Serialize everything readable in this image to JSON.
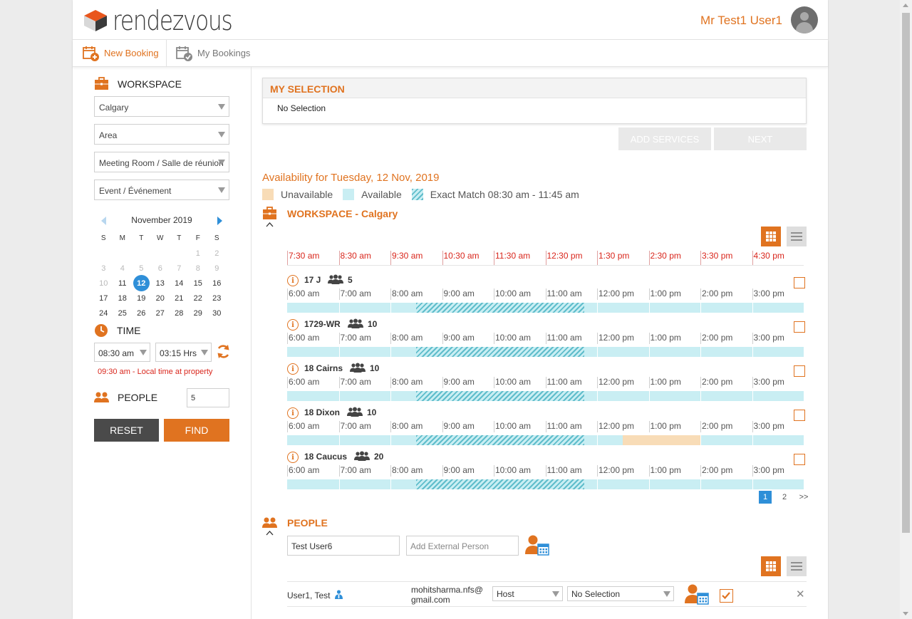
{
  "header": {
    "brand": "rendezvous",
    "user_name": "Mr Test1 User1"
  },
  "tabs": [
    {
      "label": "New Booking"
    },
    {
      "label": "My Bookings"
    }
  ],
  "sidebar": {
    "workspace_label": "WORKSPACE",
    "city": "Calgary",
    "area": "Area",
    "room_type": "Meeting Room / Salle de réunion",
    "event_type": "Event / Événement",
    "calendar": {
      "month": "November 2019",
      "dows": [
        "S",
        "M",
        "T",
        "W",
        "T",
        "F",
        "S"
      ],
      "days": [
        {
          "d": "",
          "s": ""
        },
        {
          "d": "",
          "s": ""
        },
        {
          "d": "",
          "s": ""
        },
        {
          "d": "",
          "s": ""
        },
        {
          "d": "",
          "s": ""
        },
        {
          "d": "1",
          "s": "dim"
        },
        {
          "d": "2",
          "s": "dim"
        },
        {
          "d": "3",
          "s": "dim"
        },
        {
          "d": "4",
          "s": "dim"
        },
        {
          "d": "5",
          "s": "dim"
        },
        {
          "d": "6",
          "s": "dim"
        },
        {
          "d": "7",
          "s": "dim"
        },
        {
          "d": "8",
          "s": "dim"
        },
        {
          "d": "9",
          "s": "dim"
        },
        {
          "d": "10",
          "s": "dim"
        },
        {
          "d": "11",
          "s": "day"
        },
        {
          "d": "12",
          "s": "sel"
        },
        {
          "d": "13",
          "s": "day"
        },
        {
          "d": "14",
          "s": "day"
        },
        {
          "d": "15",
          "s": "day"
        },
        {
          "d": "16",
          "s": "day"
        },
        {
          "d": "17",
          "s": "day"
        },
        {
          "d": "18",
          "s": "day"
        },
        {
          "d": "19",
          "s": "day"
        },
        {
          "d": "20",
          "s": "day"
        },
        {
          "d": "21",
          "s": "day"
        },
        {
          "d": "22",
          "s": "day"
        },
        {
          "d": "23",
          "s": "day"
        },
        {
          "d": "24",
          "s": "day"
        },
        {
          "d": "25",
          "s": "day"
        },
        {
          "d": "26",
          "s": "day"
        },
        {
          "d": "27",
          "s": "day"
        },
        {
          "d": "28",
          "s": "day"
        },
        {
          "d": "29",
          "s": "day"
        },
        {
          "d": "30",
          "s": "day"
        }
      ]
    },
    "time_label": "TIME",
    "start_time": "08:30 am",
    "duration": "03:15 Hrs",
    "local_time": "09:30 am - Local time at property",
    "people_label": "PEOPLE",
    "people_count": "5",
    "reset_label": "RESET",
    "find_label": "FIND"
  },
  "main": {
    "my_selection_title": "MY SELECTION",
    "my_selection_value": "No Selection",
    "add_services_label": "ADD SERVICES",
    "next_label": "NEXT",
    "availability_title": "Availability for Tuesday, 12 Nov, 2019",
    "legend": {
      "unavailable": "Unavailable",
      "available": "Available",
      "exact": "Exact Match 08:30 am - 11:45 am"
    },
    "workspace_title": "WORKSPACE - Calgary",
    "property_hours": [
      "7:30 am",
      "8:30 am",
      "9:30 am",
      "10:30 am",
      "11:30 am",
      "12:30 pm",
      "1:30 pm",
      "2:30 pm",
      "3:30 pm",
      "4:30 pm"
    ],
    "local_hours": [
      "6:00 am",
      "7:00 am",
      "8:00 am",
      "9:00 am",
      "10:00 am",
      "11:00 am",
      "12:00 pm",
      "1:00 pm",
      "2:00 pm",
      "3:00 pm"
    ],
    "rooms": [
      {
        "name": "17 J",
        "capacity": "5",
        "unavailable": []
      },
      {
        "name": "1729-WR",
        "capacity": "10",
        "unavailable": []
      },
      {
        "name": "18 Cairns",
        "capacity": "10",
        "unavailable": []
      },
      {
        "name": "18 Dixon",
        "capacity": "10",
        "unavailable": [
          [
            "12:30 pm",
            "2:00 pm"
          ]
        ]
      },
      {
        "name": "18 Caucus",
        "capacity": "20",
        "unavailable": []
      }
    ],
    "pagination": [
      "1",
      "2",
      ">>"
    ],
    "people_title": "PEOPLE",
    "people_search_value": "Test User6",
    "external_placeholder": "Add External Person",
    "attendee": {
      "name": "User1, Test",
      "email_line1": "mohitsharma.nfs@",
      "email_line2": "gmail.com",
      "role": "Host",
      "selection": "No Selection"
    }
  },
  "colors": {
    "accent": "#e07320",
    "available": "#c9eef3",
    "unavailable": "#f8dcb7",
    "exact": "#5fbdcb",
    "link_blue": "#2f8fd8",
    "red": "#d9261c"
  }
}
